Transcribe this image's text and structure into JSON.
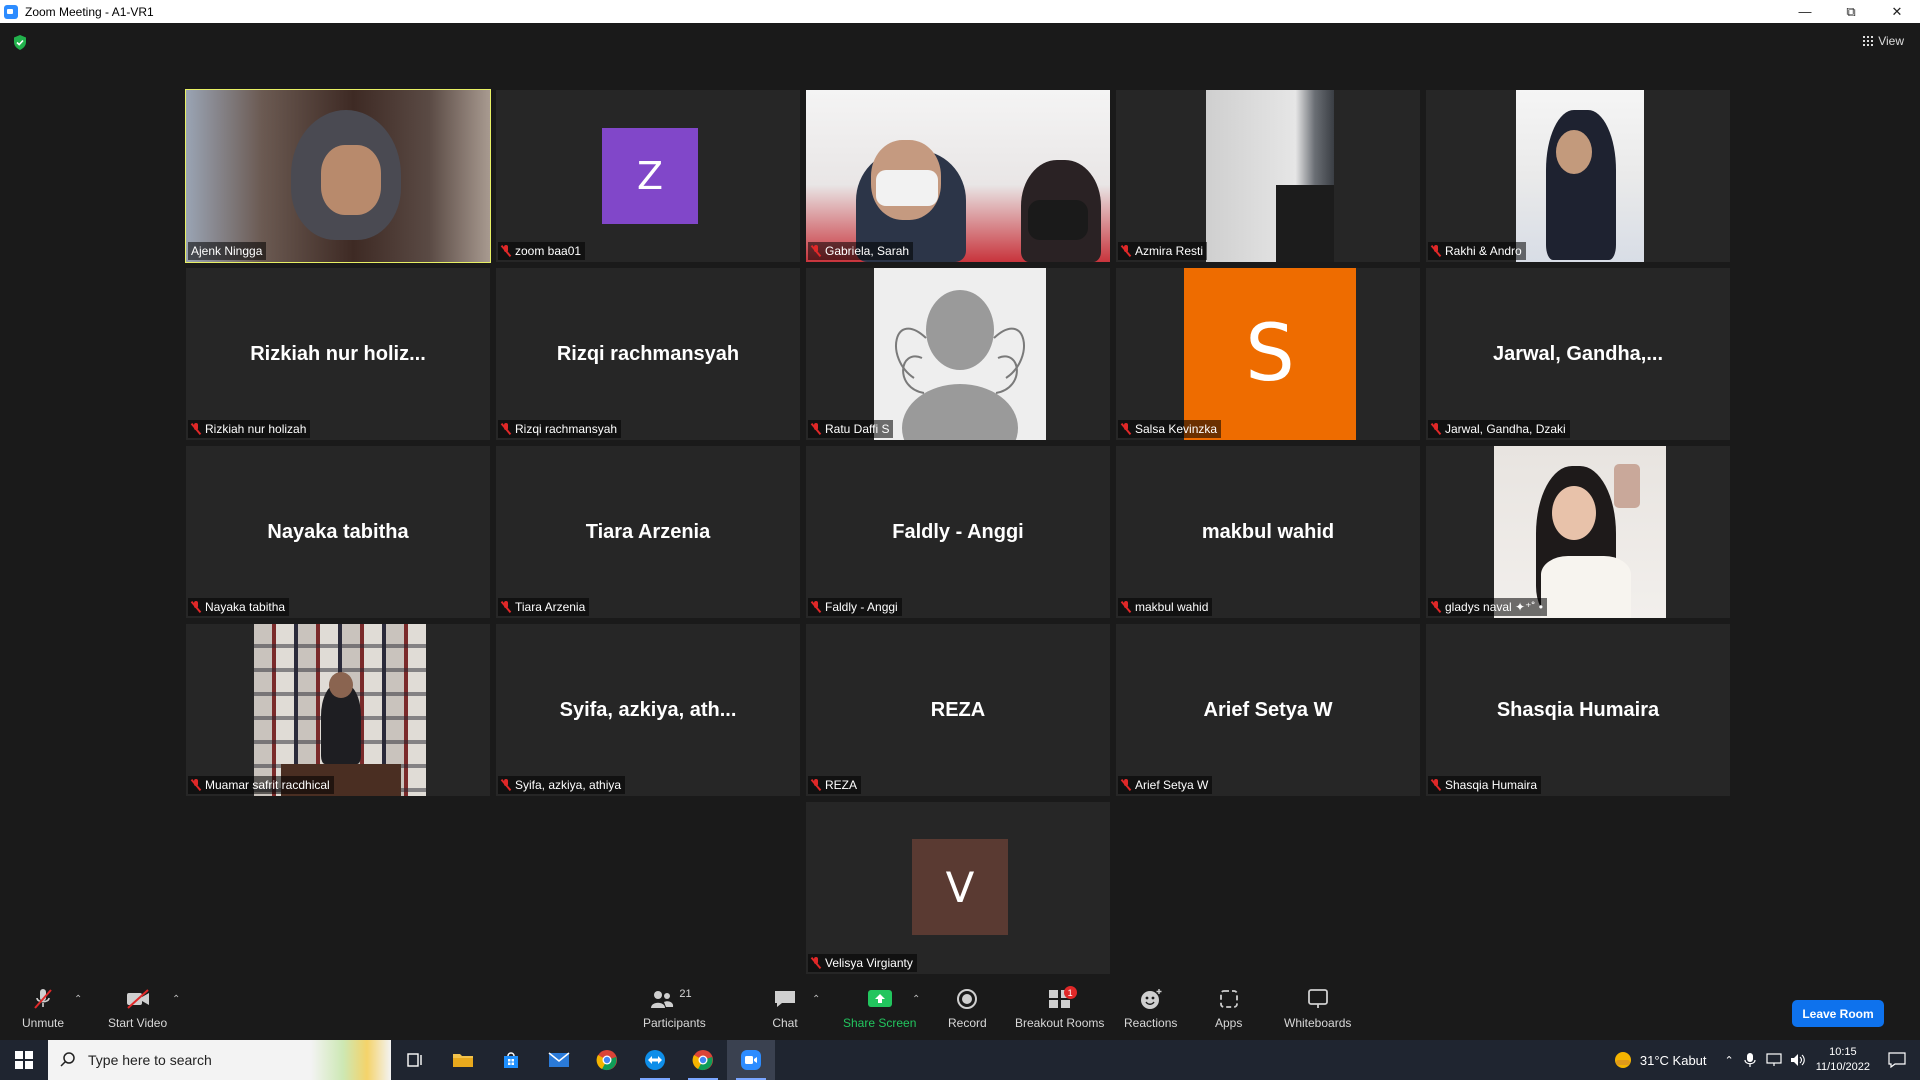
{
  "window": {
    "title": "Zoom Meeting - A1-VR1"
  },
  "topbar": {
    "view_label": "View"
  },
  "tiles": [
    {
      "name": "Ajenk Ningga"
    },
    {
      "name": "zoom baa01",
      "initial": "Z"
    },
    {
      "name": "Gabriela, Sarah"
    },
    {
      "name": "Azmira Resti"
    },
    {
      "name": "Rakhi & Andro"
    },
    {
      "name": "Rizkiah nur holizah",
      "display": "Rizkiah  nur  holiz..."
    },
    {
      "name": "Rizqi rachmansyah",
      "display": "Rizqi rachmansyah"
    },
    {
      "name": "Ratu Daffi S"
    },
    {
      "name": "Salsa Kevinzka",
      "initial": "S"
    },
    {
      "name": "Jarwal, Gandha, Dzaki",
      "display": "Jarwal,  Gandha,..."
    },
    {
      "name": "Nayaka tabitha",
      "display": "Nayaka tabitha"
    },
    {
      "name": "Tiara Arzenia",
      "display": "Tiara Arzenia"
    },
    {
      "name": "Faldly - Anggi",
      "display": "Faldly - Anggi"
    },
    {
      "name": "makbul wahid",
      "display": "makbul wahid"
    },
    {
      "name": "gladys naval ✦⁺˚ •"
    },
    {
      "name": "Muamar safrit racdhical"
    },
    {
      "name": "Syifa, azkiya, athiya",
      "display": "Syifa,  azkiya,  ath..."
    },
    {
      "name": "REZA",
      "display": "REZA"
    },
    {
      "name": "Arief Setya W",
      "display": "Arief Setya W"
    },
    {
      "name": "Shasqia Humaira",
      "display": "Shasqia Humaira"
    },
    {
      "name": "Velisya Virgianty",
      "initial": "V"
    }
  ],
  "toolbar": {
    "unmute": "Unmute",
    "start_video": "Start Video",
    "participants": "Participants",
    "participants_count": "21",
    "chat": "Chat",
    "share_screen": "Share Screen",
    "record": "Record",
    "breakout_rooms": "Breakout Rooms",
    "breakout_badge": "1",
    "reactions": "Reactions",
    "apps": "Apps",
    "whiteboards": "Whiteboards",
    "leave": "Leave Room"
  },
  "taskbar": {
    "search_placeholder": "Type here to search",
    "weather": "31°C  Kabut",
    "time": "10:15",
    "date": "11/10/2022"
  },
  "colors": {
    "active_speaker": "#e8f064",
    "zoom_avatar": "#8147c9",
    "salsa_avatar": "#ee6c00",
    "velisya_avatar": "#5a3a32",
    "share_green": "#22c55e",
    "leave_blue": "#0e72ed"
  }
}
